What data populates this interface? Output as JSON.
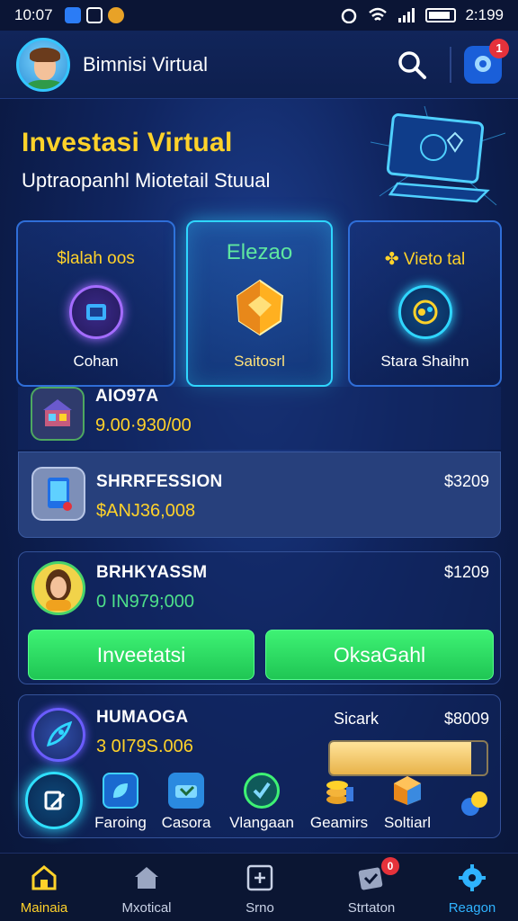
{
  "status": {
    "time": "10:07",
    "clock_right": "2:199"
  },
  "header": {
    "title": "Bimnisi Virtual",
    "notification_count": "1"
  },
  "hero": {
    "title": "Investasi Virtual",
    "subtitle": "Uptraopanhl Miotetail Stuual"
  },
  "features": [
    {
      "title": "$lalah oos",
      "label": "Cohan"
    },
    {
      "title": "Elezao",
      "label": "Saitosrl"
    },
    {
      "title": "✤ Vieto tal",
      "label": "Stara Shaihn"
    }
  ],
  "rows": [
    {
      "name": "AIO97A",
      "value": "9.00·930/00"
    },
    {
      "name": "SHRRFESSION",
      "value": "$ANJ36,008",
      "price": "$3209"
    }
  ],
  "card_c": {
    "name": "BRHKYASSM",
    "value": "0 IN979;000",
    "price": "$1209",
    "btn_left": "Inveetatsi",
    "btn_right": "OksaGahl"
  },
  "card_d": {
    "name": "HUMAOGA",
    "value": "3 0I79S.006",
    "status": "Sicark",
    "price": "$8009",
    "progress": 0.9
  },
  "shortcuts": [
    "Faroing",
    "Casora",
    "Vlangaan",
    "Geamirs",
    "Soltiarl"
  ],
  "nav": [
    {
      "label": "Mainaia"
    },
    {
      "label": "Mxotical"
    },
    {
      "label": "Srno"
    },
    {
      "label": "Strtaton",
      "badge": "0"
    },
    {
      "label": "Reagon"
    }
  ],
  "colors": {
    "accent_yellow": "#ffd22a",
    "accent_green": "#3ef274",
    "accent_cyan": "#2fd6ff",
    "bg": "#102560"
  }
}
